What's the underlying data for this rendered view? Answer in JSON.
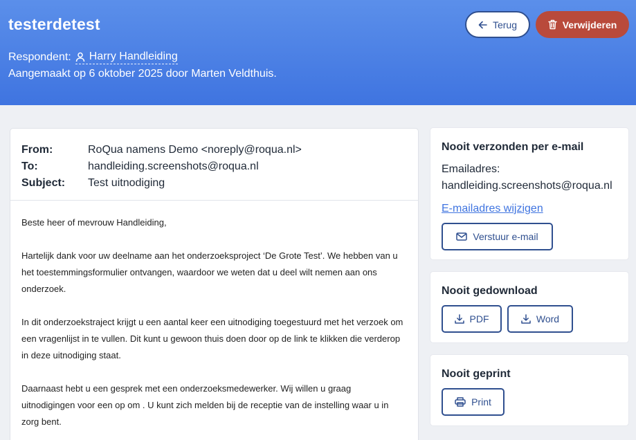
{
  "header": {
    "title": "testerdetest",
    "respondent_label": "Respondent:",
    "respondent_name": "Harry Handleiding",
    "created_text": "Aangemaakt op 6 oktober 2025 door Marten Veldthuis.",
    "back_label": "Terug",
    "delete_label": "Verwijderen"
  },
  "mail": {
    "from_label": "From:",
    "from_value": "RoQua namens Demo <noreply@roqua.nl>",
    "to_label": "To:",
    "to_value": "handleiding.screenshots@roqua.nl",
    "subject_label": "Subject:",
    "subject_value": "Test uitnodiging",
    "paragraphs": [
      "Beste heer of mevrouw Handleiding,",
      "Hartelijk dank voor uw deelname aan het onderzoeksproject ‘De Grote Test’. We hebben van u het toestemmingsformulier ontvangen, waardoor we weten dat u deel wilt nemen aan ons onderzoek.",
      "In dit onderzoekstraject krijgt u een aantal keer een uitnodiging toegestuurd met het verzoek om een vragenlijst in te vullen. Dit kunt u gewoon thuis doen door op de link te klikken die verderop in deze uitnodiging staat.",
      "Daarnaast hebt u een gesprek met een onderzoeksmedewerker. Wij willen u graag uitnodigingen voor een op om . U kunt zich melden bij de receptie van de instelling waar u in zorg bent."
    ]
  },
  "email_card": {
    "title": "Nooit verzonden per e-mail",
    "address_label": "Emailadres:",
    "address_value": "handleiding.screenshots@roqua.nl",
    "change_link": "E-mailadres wijzigen",
    "send_button": "Verstuur e-mail"
  },
  "download_card": {
    "title": "Nooit gedownload",
    "pdf_button": "PDF",
    "word_button": "Word"
  },
  "print_card": {
    "title": "Nooit geprint",
    "print_button": "Print"
  },
  "colors": {
    "header_top": "#5b8fea",
    "header_bottom": "#3f74e0",
    "delete_button": "#b94a3b",
    "outline_button": "#2f4f8f",
    "link": "#3f74e0"
  }
}
